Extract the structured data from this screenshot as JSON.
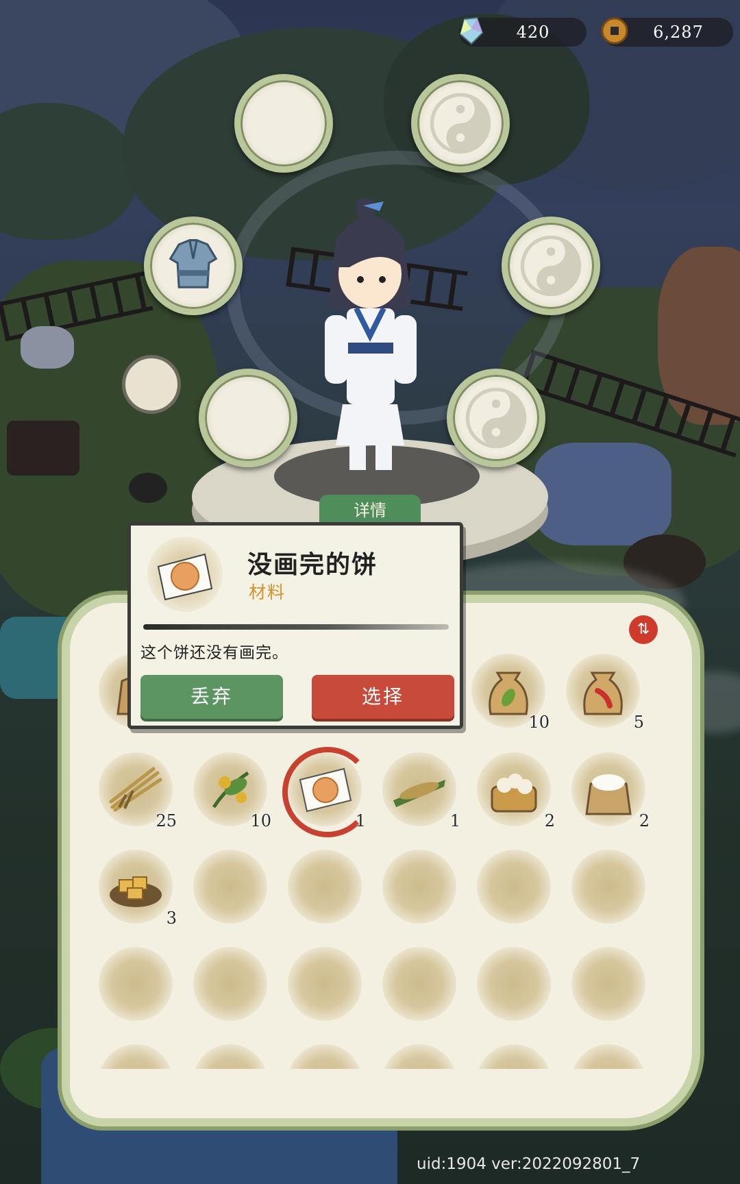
{
  "currency": {
    "gems": "420",
    "coins": "6,287",
    "gem_icon": "crystal-gem-icon",
    "coin_icon": "copper-coin-icon"
  },
  "equipment_slots": [
    {
      "name": "slot-top-left",
      "content": "empty"
    },
    {
      "name": "slot-top-right",
      "content": "yin-yang-placeholder"
    },
    {
      "name": "slot-mid-left",
      "content": "blue-armor"
    },
    {
      "name": "slot-mid-right",
      "content": "yin-yang-placeholder"
    },
    {
      "name": "slot-bottom-left",
      "content": "empty"
    },
    {
      "name": "slot-bottom-right",
      "content": "yin-yang-placeholder"
    }
  ],
  "character": {
    "detail_tab_label": "详情"
  },
  "tooltip": {
    "item_name": "没画完的饼",
    "item_category": "材料",
    "description": "这个饼还没有画完。",
    "discard_label": "丢弃",
    "select_label": "选择"
  },
  "inventory": {
    "sort_icon": "sort-swap-icon",
    "items": [
      {
        "icon": "grain-sack-icon",
        "count": ""
      },
      {
        "icon": "seed-bag-pea-icon",
        "count": "10"
      },
      {
        "icon": "seed-bag-chili-icon",
        "count": "5"
      },
      {
        "icon": "wheat-bundle-icon",
        "count": "25"
      },
      {
        "icon": "herb-flower-icon",
        "count": "10"
      },
      {
        "icon": "unfinished-pancake-icon",
        "count": "1",
        "selected": true
      },
      {
        "icon": "fish-on-leaf-icon",
        "count": "1"
      },
      {
        "icon": "steamed-buns-icon",
        "count": "2"
      },
      {
        "icon": "flour-sack-icon",
        "count": "2"
      },
      {
        "icon": "tofu-plate-icon",
        "count": "3"
      }
    ]
  },
  "footer": {
    "version_text": "uid:1904  ver:2022092801_7"
  },
  "colors": {
    "accent_red": "#c84a3a",
    "accent_green": "#5c9562",
    "category_orange": "#d6922a"
  }
}
